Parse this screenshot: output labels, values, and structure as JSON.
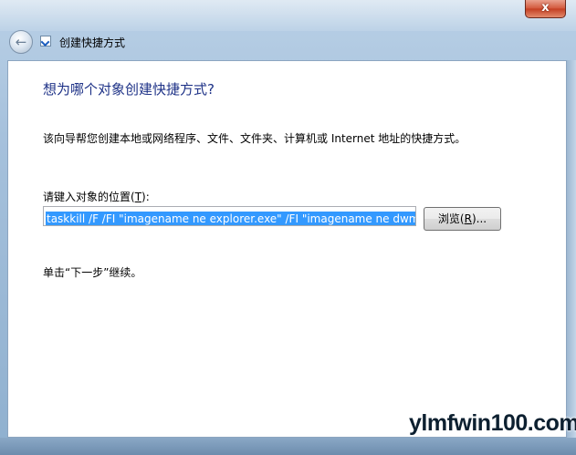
{
  "window": {
    "title": "创建快捷方式",
    "close_glyph": "x"
  },
  "nav": {
    "back_glyph": "←"
  },
  "content": {
    "heading": "想为哪个对象创建快捷方式?",
    "description": "该向导帮您创建本地或网络程序、文件、文件夹、计算机或 Internet 地址的快捷方式。",
    "location_label_prefix": "请键入对象的位置(",
    "location_label_key": "T",
    "location_label_suffix": "):",
    "location_value": "taskkill /F /FI \"imagename ne explorer.exe\" /FI \"imagename ne dwm.exe\"",
    "browse_prefix": "浏览(",
    "browse_key": "R",
    "browse_suffix": ")...",
    "hint": "单击“下一步”继续。"
  },
  "watermark": {
    "text": "ylmfwin100.com"
  }
}
